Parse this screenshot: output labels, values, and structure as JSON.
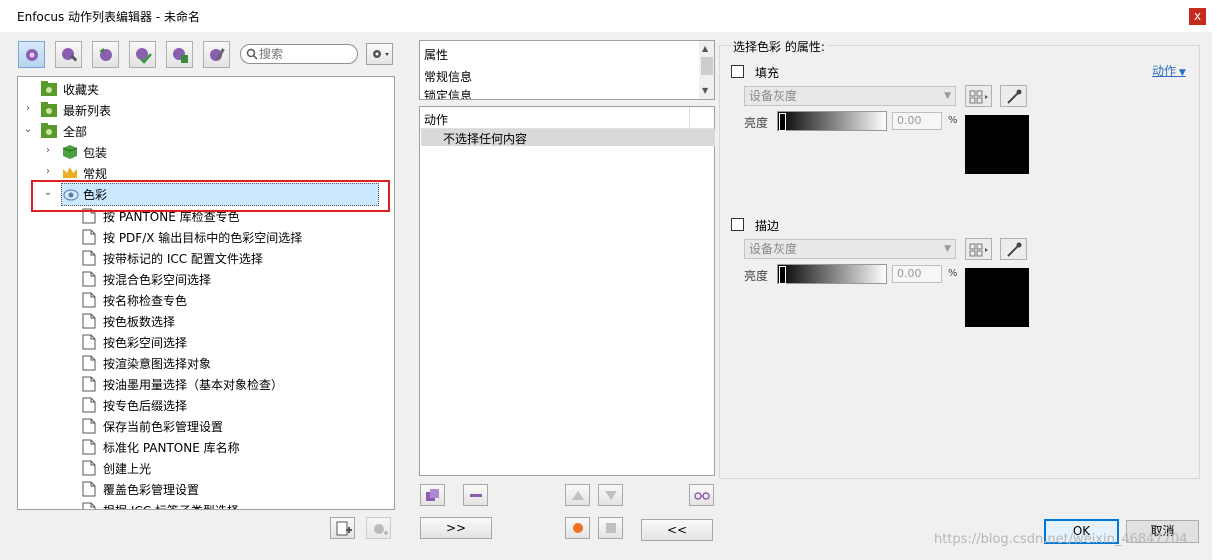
{
  "window": {
    "title": "Enfocus 动作列表编辑器 - 未命名",
    "close_glyph": "x"
  },
  "search": {
    "placeholder": "搜索"
  },
  "tree": {
    "items": [
      {
        "label": "收藏夹",
        "arrow": ""
      },
      {
        "label": "最新列表",
        "arrow": "›"
      },
      {
        "label": "全部",
        "arrow": "⌄"
      },
      {
        "label": "包装",
        "arrow": "›"
      },
      {
        "label": "常规",
        "arrow": "›"
      },
      {
        "label": "色彩",
        "arrow": "⌄"
      }
    ],
    "children": [
      "按 PANTONE 库检查专色",
      "按 PDF/X 输出目标中的色彩空间选择",
      "按带标记的 ICC 配置文件选择",
      "按混合色彩空间选择",
      "按名称检查专色",
      "按色板数选择",
      "按色彩空间选择",
      "按渲染意图选择对象",
      "按油墨用量选择（基本对象检查）",
      "按专色后缀选择",
      "保存当前色彩管理设置",
      "标准化 PANTONE 库名称",
      "创建上光",
      "覆盖色彩管理设置",
      "根据 ICC 标签子类型选择"
    ]
  },
  "properties_list": [
    "属性",
    "常规信息",
    "锁定信息"
  ],
  "actions": {
    "header": "动作",
    "item": "不选择任何内容"
  },
  "buttons": {
    "add": ">>",
    "remove": "<<",
    "ok": "OK",
    "cancel": "取消"
  },
  "right": {
    "title": "选择色彩 的属性:",
    "action_link": "动作",
    "fill": {
      "label": "填充",
      "colorspace": "设备灰度",
      "brightness_label": "亮度",
      "value": "0.00",
      "unit": "%"
    },
    "stroke": {
      "label": "描边",
      "colorspace": "设备灰度",
      "brightness_label": "亮度",
      "value": "0.00",
      "unit": "%"
    }
  },
  "watermark": "https://blog.csdn.net/weixin_46847704"
}
